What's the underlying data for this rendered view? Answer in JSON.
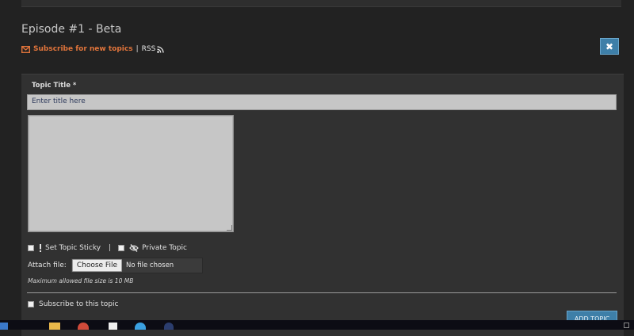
{
  "page": {
    "title": "Episode #1 - Beta",
    "subscribe_label": "Subscribe for new topics",
    "separator": "|",
    "rss_label": "RSS",
    "close_glyph": "✖"
  },
  "form": {
    "topic_title_label": "Topic Title *",
    "topic_title_placeholder": "Enter title here",
    "sticky_label": "Set Topic Sticky",
    "options_separator": "|",
    "private_label": "Private Topic",
    "attach_label": "Attach file:",
    "choose_file_label": "Choose File",
    "file_status": "No file chosen",
    "max_size_note": "Maximum allowed file size is 10 MB",
    "subscribe_topic_label": "Subscribe to this topic",
    "add_topic_label": "ADD TOPIC"
  },
  "icons": {
    "subscribe": "envelope-icon",
    "rss": "rss-icon",
    "sticky": "exclamation-icon",
    "private": "eye-slash-icon",
    "close": "close-icon"
  },
  "colors": {
    "accent_orange": "#e0743b",
    "button_blue": "#3e7fa8",
    "background": "#222222",
    "panel": "#313131",
    "input": "#c6c6c6"
  }
}
